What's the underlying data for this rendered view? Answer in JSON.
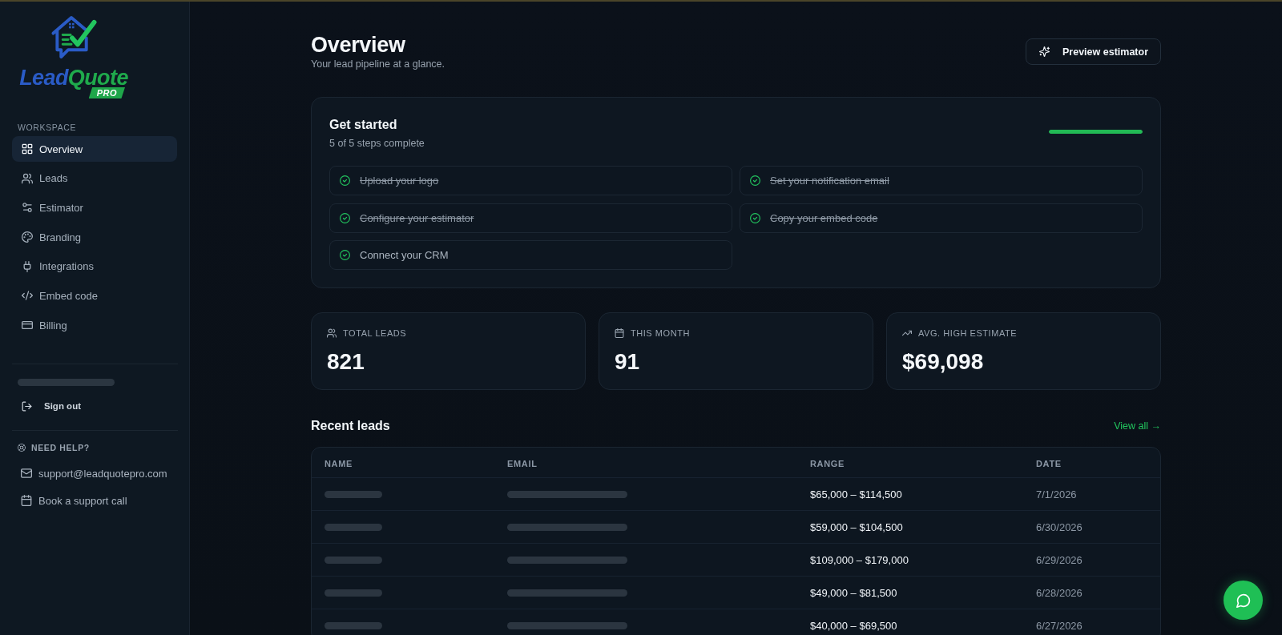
{
  "sidebar": {
    "logo": {
      "parts": [
        {
          "text": "Lead",
          "color": "#2a5bc6"
        },
        {
          "text": "Quote",
          "color": "#1faa4c"
        }
      ],
      "badge": "PRO"
    },
    "section_label": "WORKSPACE",
    "nav": [
      {
        "label": "Overview",
        "selected": true
      },
      {
        "label": "Leads",
        "selected": false
      },
      {
        "label": "Estimator",
        "selected": false
      },
      {
        "label": "Branding",
        "selected": false
      },
      {
        "label": "Integrations",
        "selected": false
      },
      {
        "label": "Embed code",
        "selected": false
      },
      {
        "label": "Billing",
        "selected": false
      }
    ],
    "account": {
      "email_blurred": true,
      "sign_out": "Sign out"
    },
    "help": {
      "title": "NEED HELP?",
      "links": [
        "support@leadquotepro.com",
        "Book a support call"
      ]
    }
  },
  "header": {
    "title": "Overview",
    "subtitle": "Your lead pipeline at a glance.",
    "action": "Preview estimator"
  },
  "get_started": {
    "title": "Get started",
    "subtitle": "5 of 5 steps complete",
    "level": 1,
    "steps": [
      {
        "label": "Upload your logo",
        "checked": true,
        "strikethrough": true
      },
      {
        "label": "Set your notification email",
        "checked": true,
        "strikethrough": true
      },
      {
        "label": "Configure your estimator",
        "checked": true,
        "strikethrough": true
      },
      {
        "label": "Copy your embed code",
        "checked": true,
        "strikethrough": true
      },
      {
        "label": "Connect your CRM",
        "checked": true,
        "strikethrough": false
      }
    ]
  },
  "stats": [
    {
      "label": "TOTAL LEADS",
      "value": "821"
    },
    {
      "label": "THIS MONTH",
      "value": "91"
    },
    {
      "label": "AVG. HIGH ESTIMATE",
      "value": "$69,098"
    }
  ],
  "recent_leads": {
    "title": "Recent leads",
    "link": "View all →",
    "columns": [
      "NAME",
      "EMAIL",
      "RANGE",
      "DATE"
    ],
    "rows": [
      {
        "name_blurred": true,
        "email_blurred": true,
        "range": "$65,000 – $114,500",
        "date": "7/1/2026"
      },
      {
        "name_blurred": true,
        "email_blurred": true,
        "range": "$59,000 – $104,500",
        "date": "6/30/2026"
      },
      {
        "name_blurred": true,
        "email_blurred": true,
        "range": "$109,000 – $179,000",
        "date": "6/29/2026"
      },
      {
        "name_blurred": true,
        "email_blurred": true,
        "range": "$49,000 – $81,500",
        "date": "6/28/2026"
      },
      {
        "name_blurred": true,
        "email_blurred": true,
        "range": "$40,000 – $69,500",
        "date": "6/27/2026"
      }
    ]
  }
}
